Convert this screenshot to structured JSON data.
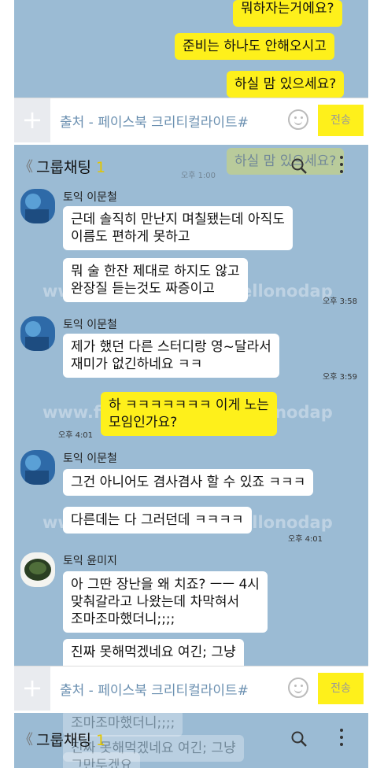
{
  "panel1": {
    "messages": [
      {
        "text": "뭐하자는거에요?"
      },
      {
        "text": "준비는 하나도 안해오시고"
      },
      {
        "text": "하실 맘 있으세요?"
      }
    ]
  },
  "input_bar": {
    "plus": "+",
    "text": "출처 - 페이스북 크리티컬라이트#",
    "send": "전송"
  },
  "header": {
    "back": "《",
    "title": "그룹채팅",
    "count": "1"
  },
  "panel2": {
    "ghost_text": "하실 맘 있으세요?",
    "ghost_time": "오후 1:00",
    "watermark": "www.facebook.com/hellonodap",
    "messages": [
      {
        "sender": "토익 이문철",
        "text": "근데 솔직히 만난지 며칠됐는데 아직도\n이름도 편하게 못하고"
      },
      {
        "text": "뭐 술 한잔 제대로 하지도 않고\n완장질 듣는것도 짜증이고",
        "time": "오후 3:58"
      },
      {
        "sender": "토익 이문철",
        "text": "제가 했던 다른 스터디랑 영~달라서\n재미가 없긴하네요 ㅋㅋ",
        "time": "오후 3:59"
      },
      {
        "text": "하 ㅋㅋㅋㅋㅋㅋㅋ 이게 노는\n모임인가요?",
        "time": "오후 4:01"
      },
      {
        "sender": "토익 이문철",
        "text": "그건 아니어도 겸사겸사 할 수 있죠 ㅋㅋㅋ"
      },
      {
        "text": "다른데는 다 그러던데 ㅋㅋㅋㅋ",
        "time": "오후 4:01"
      },
      {
        "sender": "토익 윤미지",
        "text": "아 그딴 장난을 왜 치죠? ㅡㅡ 4시\n맞춰갈라고 나왔는데 차막혀서\n조마조마했더니;;;;"
      },
      {
        "text": "진짜 못해먹겠네요 여긴; 그냥"
      }
    ]
  },
  "panel3": {
    "ghost_lines": [
      "조마조마했더니;;;;",
      "진짜 못해먹겠네요 여긴; 그냥",
      "그만두겠요"
    ]
  },
  "colors": {
    "chat_background": "#9bbbd4",
    "my_bubble": "#fef01b",
    "other_bubble": "#ffffff",
    "member_count": "#e3c600"
  },
  "icons": [
    "back-icon",
    "search-icon",
    "more-icon",
    "plus-icon",
    "emoji-icon"
  ]
}
